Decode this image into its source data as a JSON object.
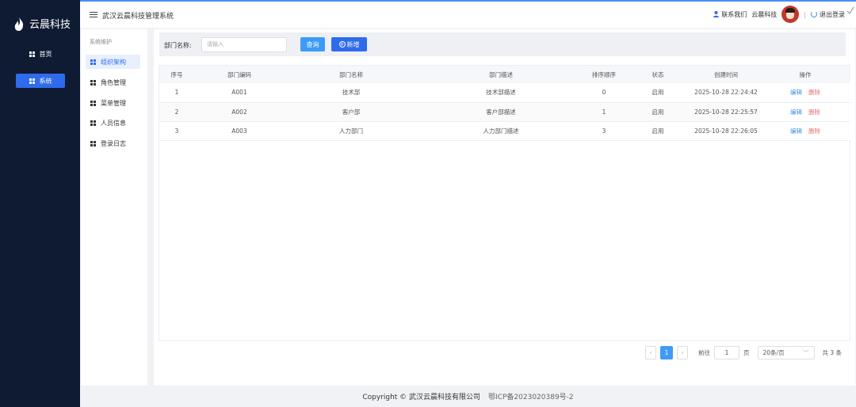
{
  "brand": {
    "name": "云晨科技"
  },
  "nav": [
    {
      "label": "首页"
    },
    {
      "label": "系统"
    }
  ],
  "header": {
    "title": "武汉云晨科技管理系统",
    "contact": "联系我们",
    "company": "云晨科技",
    "logout": "退出登录"
  },
  "submenu": {
    "heading": "系统维护",
    "items": [
      {
        "label": "组织架构"
      },
      {
        "label": "角色管理"
      },
      {
        "label": "菜单管理"
      },
      {
        "label": "人员信息"
      },
      {
        "label": "登录日志"
      }
    ]
  },
  "search": {
    "label": "部门名称:",
    "placeholder": "请输入",
    "query_button": "查询",
    "add_button": "新增"
  },
  "table": {
    "columns": [
      "序号",
      "部门编码",
      "部门名称",
      "部门描述",
      "排序顺序",
      "状态",
      "创建时间",
      "操作"
    ],
    "rows": [
      {
        "index": "1",
        "code": "A001",
        "name": "技术部",
        "desc": "技术部描述",
        "order": "0",
        "status": "启用",
        "created": "2025-10-28 22:24:42",
        "edit": "编辑",
        "delete": "删除"
      },
      {
        "index": "2",
        "code": "A002",
        "name": "客户部",
        "desc": "客户部描述",
        "order": "1",
        "status": "启用",
        "created": "2025-10-28 22:25:57",
        "edit": "编辑",
        "delete": "删除"
      },
      {
        "index": "3",
        "code": "A003",
        "name": "人力部门",
        "desc": "人力部门描述",
        "order": "3",
        "status": "启用",
        "created": "2025-10-28 22:26:05",
        "edit": "编辑",
        "delete": "删除"
      }
    ]
  },
  "pagination": {
    "current": "1",
    "goto_label": "前往",
    "goto_value": "1",
    "page_unit": "页",
    "page_size": "20条/页",
    "total": "共 3 条"
  },
  "footer": {
    "copyright": "Copyright © 武汉云晨科技有限公司",
    "icp": "鄂ICP备2023020389号-2"
  },
  "colors": {
    "sidebar": "#0f1b33",
    "accent": "#2f6bed",
    "link": "#3d8df5",
    "danger": "#f56c6c"
  }
}
